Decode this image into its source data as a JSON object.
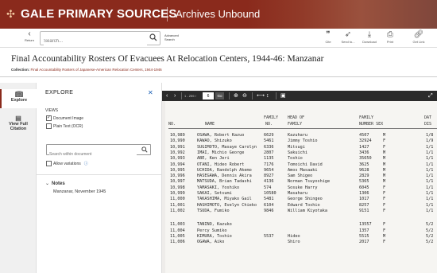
{
  "brand": {
    "logo_text": "GALE PRIMARY SOURCES",
    "product": "Archives Unbound",
    "accent": "#8a2a1c"
  },
  "toolbar": {
    "return_label": "Return",
    "search_placeholder": "Search...",
    "advanced_search": "Advanced Search",
    "tools": [
      {
        "label": "Cite",
        "icon": "cite-icon"
      },
      {
        "label": "Send to...",
        "icon": "send-icon"
      },
      {
        "label": "Download",
        "icon": "download-icon"
      },
      {
        "label": "Print",
        "icon": "print-icon"
      },
      {
        "label": "Get Link",
        "icon": "link-icon"
      }
    ]
  },
  "document": {
    "title": "Final Accountability Rosters Of Evacuees At Relocation Centers, 1944-46: Manzanar",
    "collection_label": "Collection:",
    "collection_name": "Final Accountability Rosters of Japanese-American Relocation Centers, 1944-1946"
  },
  "rail": [
    {
      "label": "Explore",
      "icon": "book-icon",
      "active": true
    },
    {
      "label": "View Full Citation",
      "icon": "citation-icon",
      "active": false
    }
  ],
  "explore": {
    "title": "EXPLORE",
    "views_label": "VIEWS",
    "view_options": [
      {
        "label": "Document Image",
        "checked": true
      },
      {
        "label": "Plain Text (OCR)",
        "checked": false
      }
    ],
    "search_within_placeholder": "Search within document",
    "allow_variations": "Allow variations",
    "notes_head": "Notes",
    "notes_text": "Manzanar, November 1945"
  },
  "viewer": {
    "page_range": "1 - 259 /",
    "page_value": "6",
    "go_label": "Go"
  },
  "roster": {
    "headers": {
      "no": "NO.",
      "name": "NAME",
      "family_no_top": "FAMILY",
      "family_no_bot": "NO.",
      "head_top": "HEAD OF",
      "head_bot": "FAMILY",
      "family_num_top": "FAMILY",
      "family_num_bot": "NUMBER SEX",
      "date_top": "DAT",
      "date_bot": "DIS"
    },
    "rows": [
      {
        "no": "10,989",
        "name": "OSAWA, Robert Kazuo",
        "fam": "6629",
        "head": "Kazuharu",
        "num": "4507",
        "sex": "M",
        "date": "1/8"
      },
      {
        "no": "10,990",
        "name": "KAWAO, Shizuko",
        "fam": "5461",
        "head": "Jimmy Toshio",
        "num": "32924",
        "sex": "F",
        "date": "1/9"
      },
      {
        "no": "10,991",
        "name": "SUGIMOTO, Masaye Carolyn",
        "fam": "6336",
        "head": "Mitsugi",
        "num": "1427",
        "sex": "F",
        "date": "1/1"
      },
      {
        "no": "10,992",
        "name": "IMAI, Michio George",
        "fam": "2807",
        "head": "Sakuichi",
        "num": "3436",
        "sex": "M",
        "date": "1/1"
      },
      {
        "no": "10,993",
        "name": "ABE, Ken Jeri",
        "fam": "1135",
        "head": "Toshio",
        "num": "35650",
        "sex": "M",
        "date": "1/1"
      },
      {
        "no": "10,994",
        "name": "OTANI, Hideo Robert",
        "fam": "7176",
        "head": "Tomoichi David",
        "num": "3625",
        "sex": "M",
        "date": "1/1"
      },
      {
        "no": "10,995",
        "name": "UCHIDA, Randolph Akemo",
        "fam": "9654",
        "head": "Amos Masaaki",
        "num": "9628",
        "sex": "M",
        "date": "1/1"
      },
      {
        "no": "10,996",
        "name": "HASEGAWA, Dennis Akira",
        "fam": "8927",
        "head": "Sam Shigeo",
        "num": "2829",
        "sex": "M",
        "date": "1/1"
      },
      {
        "no": "10,997",
        "name": "MATSUDA, Brian Tadashi",
        "fam": "4136",
        "head": "Norman Tsuyoshige",
        "num": "5365",
        "sex": "M",
        "date": "1/1"
      },
      {
        "no": "10,998",
        "name": "YAMASAKI, Yoshiko",
        "fam": "574",
        "head": "Sosuke Harry",
        "num": "6045",
        "sex": "F",
        "date": "1/1"
      },
      {
        "no": "10,999",
        "name": "SAKAI, Setsumi",
        "fam": "10580",
        "head": "Masaharu",
        "num": "1306",
        "sex": "F",
        "date": "1/1"
      },
      {
        "no": "11,000",
        "name": "TAKASHIMA, Miyako Gail",
        "fam": "5481",
        "head": "George Shingeo",
        "num": "1017",
        "sex": "F",
        "date": "1/1"
      },
      {
        "no": "11,001",
        "name": "HASHIMOTO, Evelyn Chieko",
        "fam": "6104",
        "head": "Edward Toshio",
        "num": "8257",
        "sex": "F",
        "date": "1/1"
      },
      {
        "no": "11,002",
        "name": "TSUDA, Fumiko",
        "fam": "9846",
        "head": "William Kiyotaka",
        "num": "9151",
        "sex": "F",
        "date": "1/1"
      },
      {
        "no": "11,003",
        "name": "TANINO, Kazuko",
        "fam": "",
        "head": "",
        "num": "13557",
        "sex": "F",
        "date": "5/2"
      },
      {
        "no": "11,004",
        "name": "Percy Sumiko",
        "fam": "",
        "head": "",
        "num": "1357",
        "sex": "F",
        "date": "5/2"
      },
      {
        "no": "11,005",
        "name": "KIMURA, Toshio",
        "fam": "5537",
        "head": "Hideo",
        "num": "5515",
        "sex": "M",
        "date": "5/2"
      },
      {
        "no": "11,006",
        "name": "OGAWA, Aiko",
        "fam": "",
        "head": "Shiro",
        "num": "2017",
        "sex": "F",
        "date": "5/2"
      }
    ]
  }
}
